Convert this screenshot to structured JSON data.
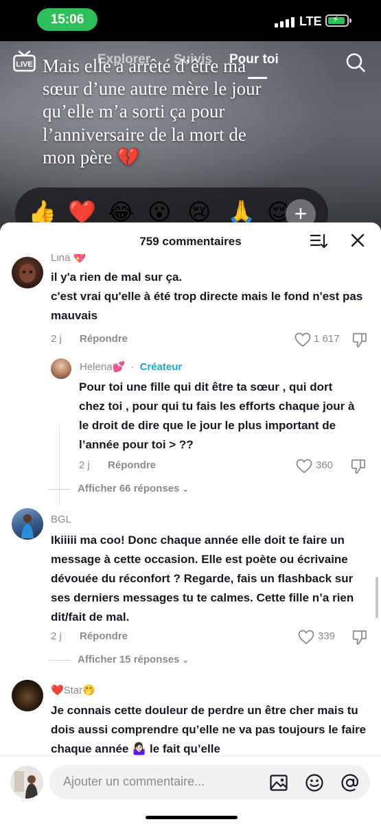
{
  "status_bar": {
    "time": "15:06",
    "network": "LTE"
  },
  "top_nav": {
    "live_label": "LIVE",
    "tabs": [
      {
        "label": "Explorer"
      },
      {
        "label": "Suivis"
      },
      {
        "label": "Pour toi"
      }
    ],
    "active_tab": "Pour toi"
  },
  "video": {
    "overlay_text": "Mais elle a arrêté d’être ma sœur d’une autre mère le jour qu’elle m’a sorti ça pour l’anniversaire de la mort de mon père 💔"
  },
  "emoji_bar": {
    "emojis": [
      "👍",
      "❤️",
      "😂",
      "😮",
      "😢",
      "🙏",
      "😌"
    ],
    "plus_label": "+"
  },
  "comments_sheet": {
    "title": "759 commentaires",
    "comments": [
      {
        "username": "Lina 💖",
        "text": "il y'a rien de mal sur ça.\nc'est vrai qu'elle à été trop directe mais le fond n'est pas mauvais",
        "date": "2 j",
        "reply_label": "Répondre",
        "likes": "1 617"
      },
      {
        "username": "Helena💕",
        "creator_badge": "Créateur",
        "separator": "·",
        "text": "Pour toi une fille qui dit être ta sœur , qui dort chez toi , pour qui tu fais les efforts chaque jour à le droit de dire que le jour le plus important de l’année pour toi > ??",
        "date": "2 j",
        "reply_label": "Répondre",
        "likes": "360"
      },
      {
        "view_replies": "Afficher 66 réponses"
      },
      {
        "username": "BGL",
        "text": "Ikiiiii ma coo! Donc chaque année elle doit te faire un message à cette occasion. Elle est poète ou écrivaine dévouée du réconfort ? Regarde, fais un flashback sur ses derniers messages tu te calmes. Cette fille n’a rien dit/fait de mal.",
        "date": "2 j",
        "reply_label": "Répondre",
        "likes": "339"
      },
      {
        "view_replies": "Afficher 15 réponses"
      },
      {
        "username": "❤️Star🤭",
        "text": "Je connais cette douleur de perdre un être cher mais tu dois aussi comprendre qu’elle ne va pas toujours le faire chaque année 🤷🏻‍♀️ le fait qu’elle"
      }
    ]
  },
  "comment_input": {
    "placeholder": "Ajouter un commentaire..."
  },
  "colors": {
    "status_pill": "#2fbf5a",
    "creator_badge": "#20a6c7",
    "text_primary": "#161823",
    "text_secondary": "#8a8b91"
  }
}
